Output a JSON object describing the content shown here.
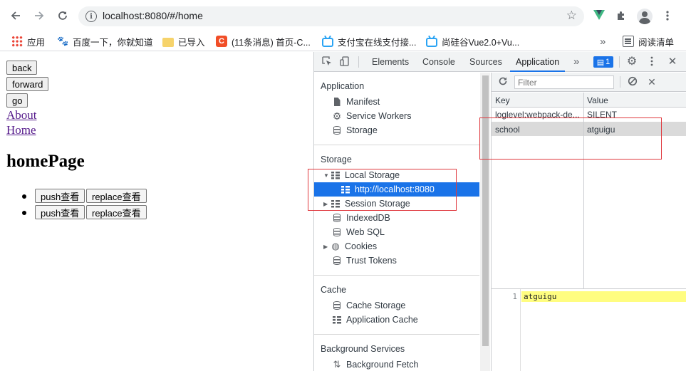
{
  "browser": {
    "url": "localhost:8080/#/home",
    "bookmarks": [
      {
        "label": "应用",
        "icon": "apps-grid-icon"
      },
      {
        "label": "百度一下，你就知道",
        "icon": "baidu-paw-icon"
      },
      {
        "label": "已导入",
        "icon": "folder-icon"
      },
      {
        "label": "(11条消息) 首页-C...",
        "icon": "csdn-icon"
      },
      {
        "label": "支付宝在线支付接...",
        "icon": "bilibili-tv-icon"
      },
      {
        "label": "尚硅谷Vue2.0+Vu...",
        "icon": "bilibili-tv-icon"
      }
    ],
    "more_bookmarks": "»",
    "reading_list": "阅读清单"
  },
  "page": {
    "buttons": {
      "back": "back",
      "forward": "forward",
      "go": "go"
    },
    "links": {
      "about": "About",
      "home": "Home"
    },
    "heading": "homePage",
    "messages": [
      {
        "push": "push查看",
        "replace": "replace查看"
      },
      {
        "push": "push查看",
        "replace": "replace查看"
      }
    ]
  },
  "devtools": {
    "tabs": [
      "Elements",
      "Console",
      "Sources",
      "Application"
    ],
    "active_tab": "Application",
    "more_tabs": "»",
    "issues_count": "1",
    "sidebar": {
      "application_header": "Application",
      "application_items": [
        "Manifest",
        "Service Workers",
        "Storage"
      ],
      "storage_header": "Storage",
      "local_storage": "Local Storage",
      "local_storage_origin": "http://localhost:8080",
      "session_storage": "Session Storage",
      "storage_items": [
        "IndexedDB",
        "Web SQL",
        "Cookies",
        "Trust Tokens"
      ],
      "cache_header": "Cache",
      "cache_items": [
        "Cache Storage",
        "Application Cache"
      ],
      "background_header": "Background Services",
      "background_items": [
        "Background Fetch"
      ]
    },
    "filter_placeholder": "Filter",
    "table": {
      "columns": [
        "Key",
        "Value"
      ],
      "rows": [
        {
          "key": "loglevel:webpack-de...",
          "value": "SILENT"
        },
        {
          "key": "school",
          "value": "atguigu"
        }
      ],
      "selected_row": 1
    },
    "preview": {
      "line_number": "1",
      "content": "atguigu"
    },
    "highlight_color": "#e0393e",
    "accent_color": "#1a73e8"
  }
}
